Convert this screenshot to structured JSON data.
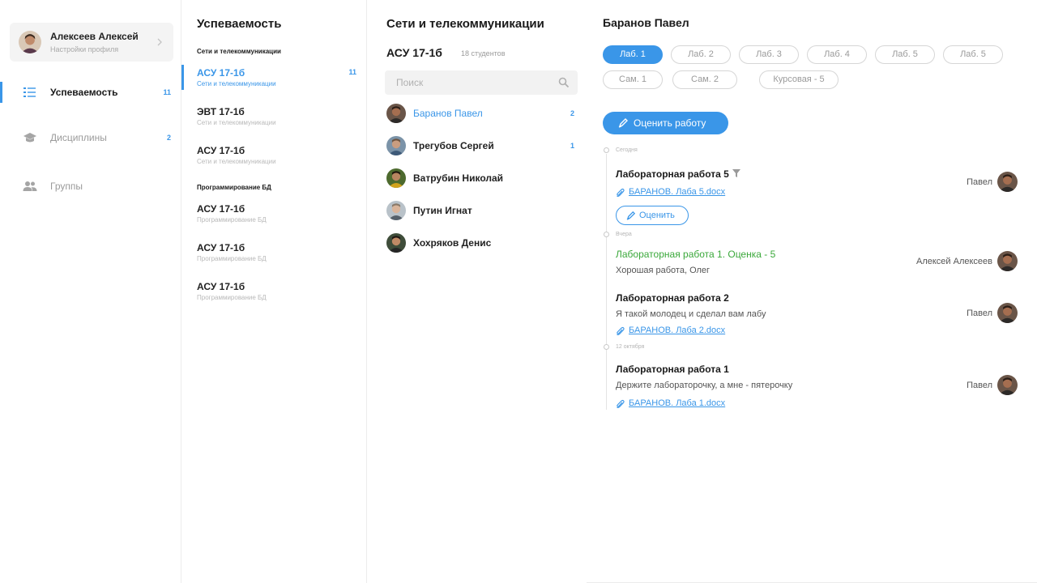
{
  "profile": {
    "name": "Алексеев Алексей",
    "subtitle": "Настройки профиля"
  },
  "nav": {
    "items": [
      {
        "label": "Успеваемость",
        "count": "11",
        "icon": "list-icon",
        "active": true
      },
      {
        "label": "Дисциплины",
        "count": "2",
        "icon": "graduation-cap-icon",
        "active": false
      },
      {
        "label": "Группы",
        "count": "",
        "icon": "people-icon",
        "active": false
      }
    ]
  },
  "groups": {
    "title": "Успеваемость",
    "sections": [
      {
        "title": "Сети и телекоммуникации",
        "items": [
          {
            "name": "АСУ 17-1б",
            "sub": "Сети и телекоммуникации",
            "count": "11",
            "active": true
          },
          {
            "name": "ЭВТ 17-1б",
            "sub": "Сети и телекоммуникации",
            "count": ""
          },
          {
            "name": "АСУ 17-1б",
            "sub": "Сети и телекоммуникации",
            "count": ""
          }
        ]
      },
      {
        "title": "Программирование БД",
        "items": [
          {
            "name": "АСУ 17-1б",
            "sub": "Программирование БД",
            "count": ""
          },
          {
            "name": "АСУ 17-1б",
            "sub": "Программирование БД",
            "count": ""
          },
          {
            "name": "АСУ 17-1б",
            "sub": "Программирование БД",
            "count": ""
          }
        ]
      }
    ]
  },
  "students": {
    "title": "Сети и телекоммуникации",
    "group": "АСУ 17-1б",
    "group_count": "18 студентов",
    "search_placeholder": "Поиск",
    "items": [
      {
        "name": "Баранов Павел",
        "count": "2",
        "active": true
      },
      {
        "name": "Трегубов Сергей",
        "count": "1"
      },
      {
        "name": "Ватрубин Николай",
        "count": ""
      },
      {
        "name": "Путин Игнат",
        "count": ""
      },
      {
        "name": "Хохряков Денис",
        "count": ""
      }
    ]
  },
  "detail": {
    "student": "Баранов Павел",
    "tabs_row1": [
      "Лаб. 1",
      "Лаб. 2",
      "Лаб. 3",
      "Лаб. 4",
      "Лаб. 5",
      "Лаб. 5"
    ],
    "tabs_row2": [
      "Сам. 1",
      "Сам. 2",
      "Курсовая - 5"
    ],
    "rate_button": "Оценить работу",
    "timeline": {
      "dates": [
        "Сегодня",
        "Вчера",
        "12 октября"
      ],
      "entries": [
        {
          "title": "Лабораторная работа 5",
          "text": "",
          "file": "БАРАНОВ. Лаба 5.docx",
          "author": "Павел",
          "action": "Оценить"
        },
        {
          "title": "Лабораторная работа 1. Оценка - 5",
          "text": "Хорошая работа, Олег",
          "file": "",
          "author": "Алексей Алексеев"
        },
        {
          "title": "Лабораторная работа 2",
          "text": "Я такой молодец и сделал вам лабу",
          "file": "БАРАНОВ. Лаба 2.docx",
          "author": "Павел"
        },
        {
          "title": "Лабораторная работа 1",
          "text": "Держите лабораторочку, а мне - пятерочку",
          "file": "БАРАНОВ. Лаба 1.docx",
          "author": "Павел"
        }
      ]
    }
  },
  "colors": {
    "accent": "#3a96e8",
    "grade": "#3aa83a",
    "muted": "#9a9a9a"
  }
}
